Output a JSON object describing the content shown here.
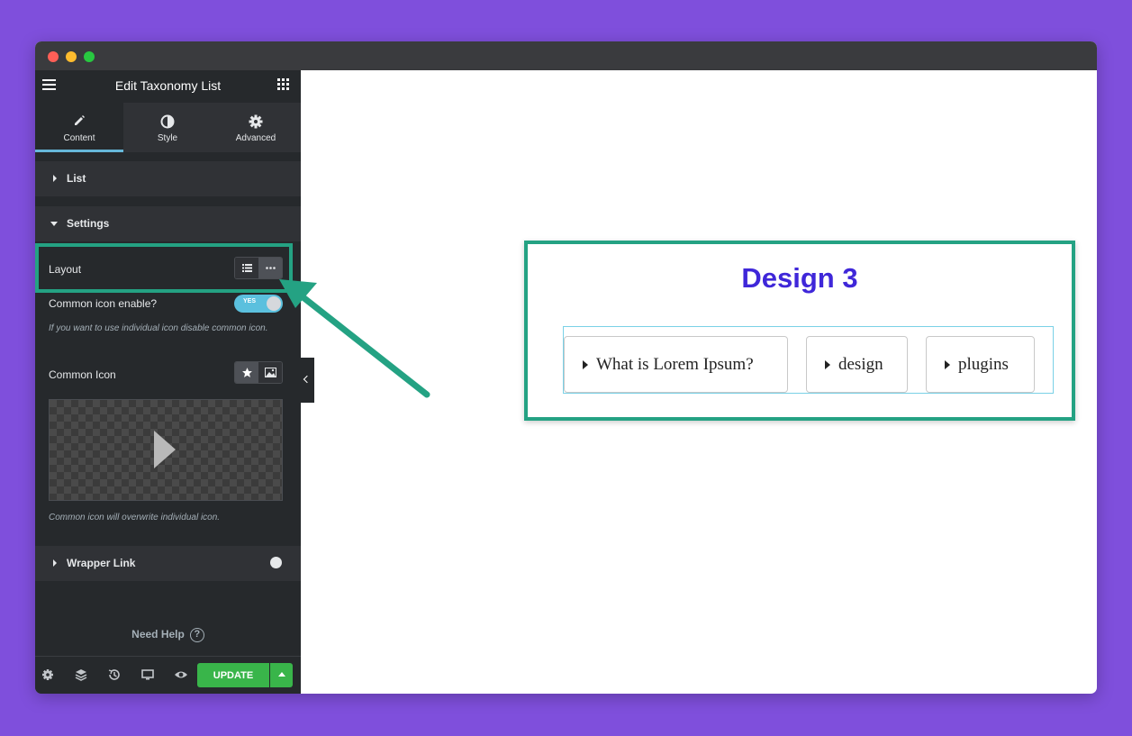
{
  "panel": {
    "title": "Edit Taxonomy List",
    "tabs": [
      {
        "label": "Content",
        "icon": "pencil-icon",
        "active": true
      },
      {
        "label": "Style",
        "icon": "contrast-icon",
        "active": false
      },
      {
        "label": "Advanced",
        "icon": "gear-icon",
        "active": false
      }
    ],
    "sections": {
      "list": "List",
      "settings": "Settings",
      "wrapper_link": "Wrapper Link"
    },
    "settings": {
      "layout_label": "Layout",
      "common_icon_enable_label": "Common icon enable?",
      "toggle_text": "YES",
      "toggle_hint": "If you want to use individual icon disable common icon.",
      "common_icon_label": "Common Icon",
      "preview_hint": "Common icon will overwrite individual icon."
    },
    "need_help": "Need Help",
    "help_glyph": "?",
    "footer": {
      "update_label": "UPDATE"
    }
  },
  "widget": {
    "title": "Design 3",
    "items": [
      "What is Lorem Ipsum?",
      "design",
      "plugins"
    ]
  },
  "colors": {
    "background": "#7f4fdc",
    "highlight": "#24a283",
    "widget_title": "#3f27d9",
    "update_button": "#39b54a"
  }
}
